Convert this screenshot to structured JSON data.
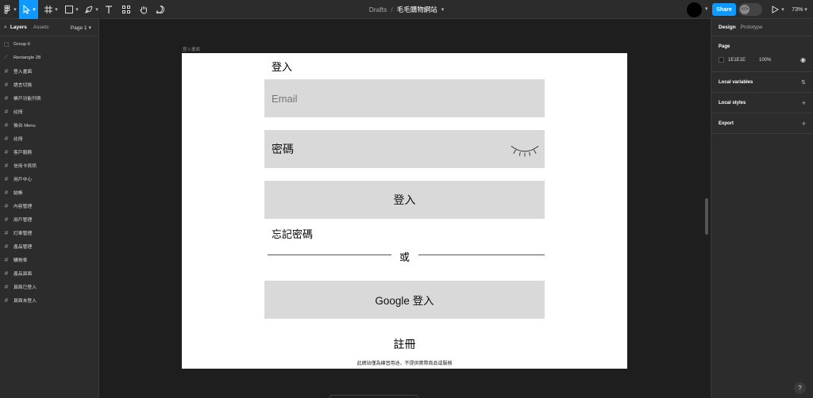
{
  "topbar": {
    "breadcrumb_root": "Drafts",
    "separator": "/",
    "file_name": "毛毛購物網站",
    "share_label": "Share",
    "zoom": "73%"
  },
  "left_panel": {
    "tabs": [
      "Layers",
      "Assets"
    ],
    "page_selector": "Page 1",
    "layers": [
      {
        "icon": "□",
        "name": "Group 6"
      },
      {
        "icon": "⟋",
        "name": "Rectangle 28"
      },
      {
        "icon": "#",
        "name": "登入畫面"
      },
      {
        "icon": "#",
        "name": "語言切換"
      },
      {
        "icon": "#",
        "name": "帳戶功能列表"
      },
      {
        "icon": "#",
        "name": "註冊"
      },
      {
        "icon": "#",
        "name": "後台 Menu"
      },
      {
        "icon": "#",
        "name": "註冊"
      },
      {
        "icon": "#",
        "name": "客戶服務"
      },
      {
        "icon": "#",
        "name": "信用卡資訊"
      },
      {
        "icon": "#",
        "name": "用戶中心"
      },
      {
        "icon": "#",
        "name": "結帳"
      },
      {
        "icon": "#",
        "name": "內容管理"
      },
      {
        "icon": "#",
        "name": "用戶管理"
      },
      {
        "icon": "#",
        "name": "訂單管理"
      },
      {
        "icon": "#",
        "name": "產品管理"
      },
      {
        "icon": "#",
        "name": "購物車"
      },
      {
        "icon": "#",
        "name": "產品頁面"
      },
      {
        "icon": "#",
        "name": "頁面已登入"
      },
      {
        "icon": "#",
        "name": "頁面未登入"
      }
    ]
  },
  "right_panel": {
    "tabs": [
      "Design",
      "Prototype"
    ],
    "page_section": {
      "title": "Page",
      "color_hex": "1E1E1E",
      "opacity": "100%"
    },
    "sections": [
      "Local variables",
      "Local styles",
      "Export"
    ]
  },
  "canvas": {
    "frame_label": "登入畫面",
    "login": {
      "heading": "登入",
      "email_placeholder": "Email",
      "password_label": "密碼",
      "login_button": "登入",
      "forgot_password": "忘記密碼",
      "or_text": "或",
      "google_button": "Google 登入",
      "register": "註冊",
      "disclaimer": "此網站僅為練習用途，不提供實際商品或服務"
    }
  },
  "help_label": "?",
  "colors": {
    "accent": "#0d99ff",
    "canvas_bg": "#1e1e1e",
    "panel_bg": "#2c2c2c",
    "input_bg": "#d9d9d9"
  }
}
